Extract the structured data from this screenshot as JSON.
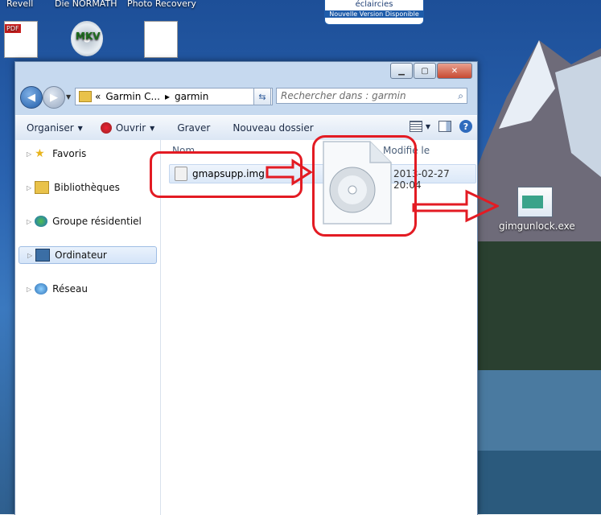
{
  "desktop": {
    "top_partial_texts": [
      "Revell",
      "Die NORMATH",
      "Photo Recovery"
    ],
    "badge": {
      "line1": "éclaircies",
      "line2": "Nouvelle Version Disponible"
    },
    "icons": [
      {
        "name": "pdf-icon",
        "label": "PDF"
      },
      {
        "name": "mkv-icon",
        "label": "MKV"
      },
      {
        "name": "blank-file-icon",
        "label": ""
      }
    ],
    "exe_label": "gimgunlock.exe"
  },
  "window": {
    "address": {
      "prefix": "«",
      "crumb1": "Garmin C...",
      "crumb2": "garmin"
    },
    "search_placeholder": "Rechercher dans : garmin",
    "toolbar": {
      "organize": "Organiser",
      "open": "Ouvrir",
      "burn": "Graver",
      "new_folder": "Nouveau dossier"
    },
    "sidebar": [
      {
        "label": "Favoris",
        "icon": "star-icon"
      },
      {
        "label": "Bibliothèques",
        "icon": "library-icon"
      },
      {
        "label": "Groupe résidentiel",
        "icon": "homegroup-icon"
      },
      {
        "label": "Ordinateur",
        "icon": "computer-icon",
        "selected": true
      },
      {
        "label": "Réseau",
        "icon": "network-icon"
      }
    ],
    "columns": {
      "name": "Nom",
      "modified": "Modifié le"
    },
    "file": {
      "name": "gmapsupp.img",
      "date": "2013-02-27 20:04"
    }
  },
  "colors": {
    "annotation_red": "#e31b23"
  }
}
